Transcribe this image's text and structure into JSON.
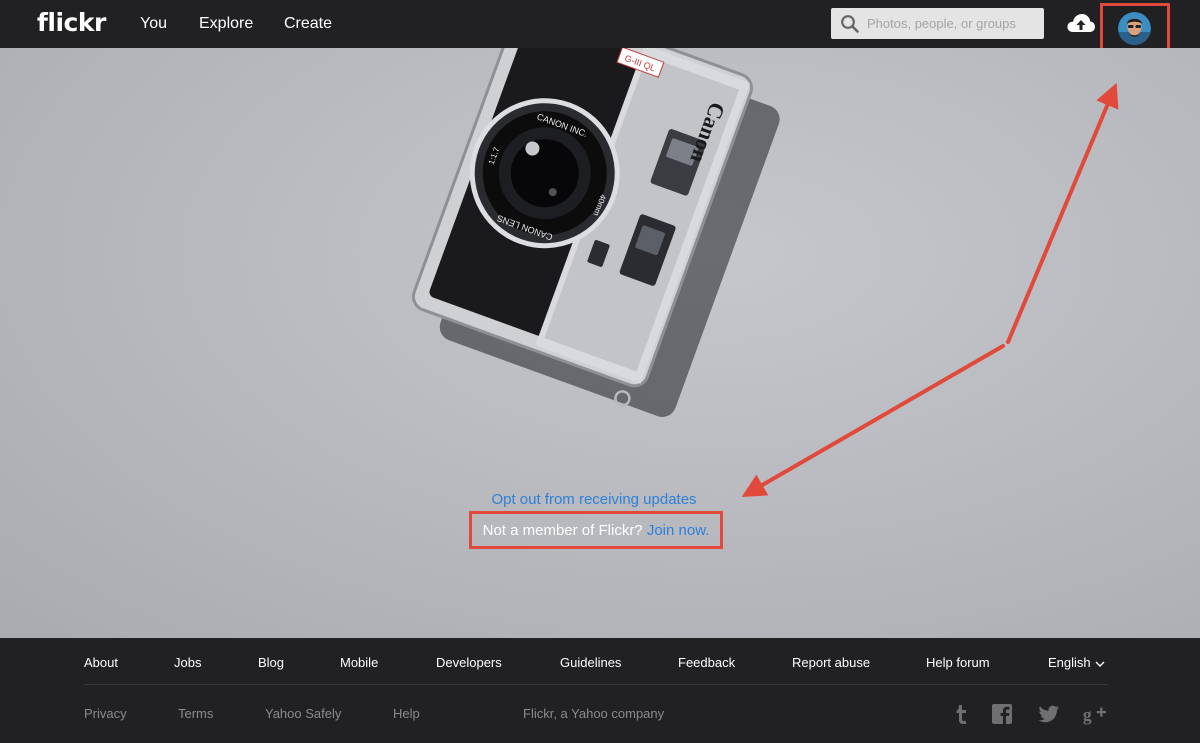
{
  "header": {
    "logo": "flickr",
    "nav": [
      "You",
      "Explore",
      "Create"
    ],
    "search_placeholder": "Photos, people, or groups",
    "icons": [
      "search-icon",
      "upload-cloud-icon",
      "avatar"
    ]
  },
  "hero": {
    "camera_brand": "Canon",
    "camera_model_badge": "G-III QL",
    "lens_ring_top": "CANON INC.",
    "lens_ring_bottom": "CANON LENS",
    "lens_spec_left": "1:1.7",
    "lens_spec_right": "40mm",
    "opt_out": "Opt out from receiving updates",
    "member_text": "Not a member of Flickr?",
    "join_link": "Join now."
  },
  "annotations": {
    "highlight_color": "#e1493a",
    "items": [
      "highlight-box-avatar",
      "highlight-box-join",
      "arrow-to-avatar",
      "arrow-to-opt-out"
    ]
  },
  "footer": {
    "links": [
      "About",
      "Jobs",
      "Blog",
      "Mobile",
      "Developers",
      "Guidelines",
      "Feedback",
      "Report abuse",
      "Help forum"
    ],
    "language": "English",
    "sub_links": [
      "Privacy",
      "Terms",
      "Yahoo Safely",
      "Help"
    ],
    "company": "Flickr, a Yahoo company",
    "social_icons": [
      "tumblr-icon",
      "facebook-icon",
      "twitter-icon",
      "google-plus-icon"
    ]
  },
  "colors": {
    "nav_bg": "#212124",
    "link_blue": "#2f80d8",
    "annotation_red": "#e1493a"
  }
}
